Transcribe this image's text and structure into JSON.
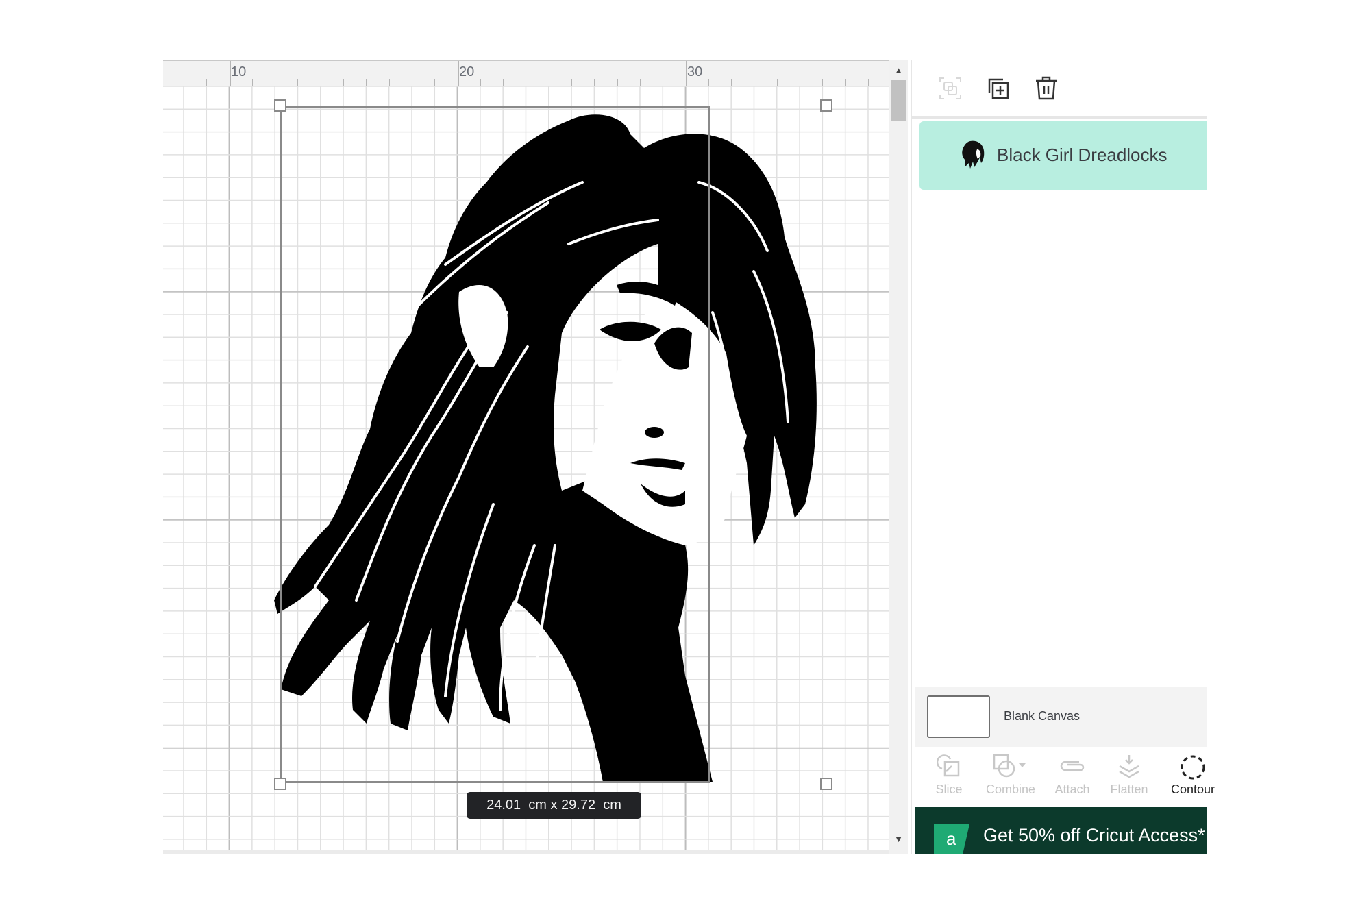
{
  "canvas": {
    "ruler_labels": [
      "10",
      "20",
      "30"
    ],
    "ruler_label_values_cm": [
      10,
      20,
      30
    ],
    "ruler_origin_cm": 7.1,
    "selected_object_size_label": "24.01  cm x 29.72  cm",
    "artwork_name": "black-girl-dreadlocks-silhouette"
  },
  "scrollbar": {
    "up_icon": "triangle-up",
    "down_icon": "triangle-down",
    "position_fraction": 0.0
  },
  "panel": {
    "toolbar": [
      {
        "name": "group",
        "icon": "group-icon",
        "enabled": false
      },
      {
        "name": "duplicate",
        "icon": "duplicate-icon",
        "enabled": true
      },
      {
        "name": "delete",
        "icon": "trash-icon",
        "enabled": true
      }
    ],
    "layers": [
      {
        "name": "Black Girl Dreadlocks",
        "selected": true,
        "highlight_color": "#b8eee0"
      }
    ],
    "canvas_background": {
      "label": "Blank Canvas"
    },
    "operations": [
      {
        "label": "Slice",
        "icon": "slice-icon",
        "enabled": false
      },
      {
        "label": "Combine",
        "icon": "combine-icon",
        "enabled": false,
        "has_dropdown": true
      },
      {
        "label": "Attach",
        "icon": "attach-icon",
        "enabled": false
      },
      {
        "label": "Flatten",
        "icon": "flatten-icon",
        "enabled": false
      },
      {
        "label": "Contour",
        "icon": "contour-icon",
        "enabled": true
      }
    ],
    "promo_banner": {
      "badge_letter": "a",
      "text": "Get 50% off Cricut Access*",
      "background_color": "#0c3a2c",
      "badge_color": "#1faa74"
    }
  }
}
